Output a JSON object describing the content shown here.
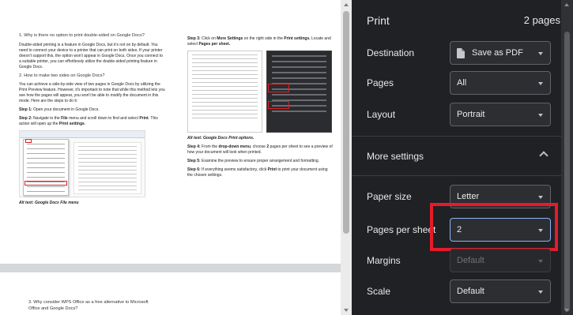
{
  "preview": {
    "left_col": {
      "q1": "1. Why is there no option to print double-sided on Google Docs?",
      "p1": "Double-sided printing is a feature in Google Docs, but it's not on by default. You need to connect your device to a printer that can print on both sides. If your printer doesn't support this, the option won't appear in Google Docs. Once you connect to a suitable printer, you can effortlessly utilize the double-sided printing feature in Google Docs.",
      "q2": "2. How to make two sides on Google Docs?",
      "p2": "You can achieve a side-by-side view of two pages in Google Docs by utilizing the Print Preview feature. However, it's important to note that while this method lets you see how the pages will appear, you won't be able to modify the document in this mode. Here are the steps to do it:",
      "step1_b": "Step 1:",
      "step1": " Open your document in Google Docs.",
      "step2_b": "Step 2:",
      "step2a": " Navigate to the ",
      "step2_file": "File",
      "step2b": " menu and scroll down to find and select ",
      "step2_print": "Print",
      "step2c": ". This action will open up the ",
      "step2_ps": "Print settings",
      "step2d": ".",
      "alt": "Alt text: Google Docs File menu"
    },
    "right_col": {
      "step3_b": "Step 3:",
      "step3a": " Click on ",
      "step3_more": "More Settings",
      "step3b": " on the right side in the ",
      "step3_ps": "Print settings.",
      "step3c": " Locate and select ",
      "step3_pps": "Pages per sheet.",
      "alt": "Alt text: Google Docs Print options.",
      "step4_b": "Step 4:",
      "step4a": " From the ",
      "step4_dd": "drop-down menu",
      "step4b": ", choose ",
      "step4_2": "2",
      "step4c": " pages per sheet to see a preview of how your document will look when printed.",
      "step5_b": "Step 5:",
      "step5": " Examine the preview to ensure proper arrangement and formatting.",
      "step6_b": "Step 6:",
      "step6a": " If everything seems satisfactory, click ",
      "step6_print": "Print",
      "step6b": " to print your document using the chosen settings."
    },
    "page2": {
      "q3": "3. Why consider WPS Office as a free alternative to Microsoft Office and Google Docs?"
    }
  },
  "print_panel": {
    "title": "Print",
    "page_count": "2 pages",
    "destination": {
      "label": "Destination",
      "value": "Save as PDF"
    },
    "pages": {
      "label": "Pages",
      "value": "All"
    },
    "layout": {
      "label": "Layout",
      "value": "Portrait"
    },
    "more_settings": {
      "label": "More settings",
      "expanded": true
    },
    "paper_size": {
      "label": "Paper size",
      "value": "Letter"
    },
    "pages_per_sheet": {
      "label": "Pages per sheet",
      "value": "2"
    },
    "margins": {
      "label": "Margins",
      "value": "Default",
      "disabled": true
    },
    "scale": {
      "label": "Scale",
      "value": "Default"
    }
  },
  "colors": {
    "panel_bg": "#202124",
    "highlight_red": "#e51b2b",
    "focus_blue": "#8ab4f8"
  }
}
